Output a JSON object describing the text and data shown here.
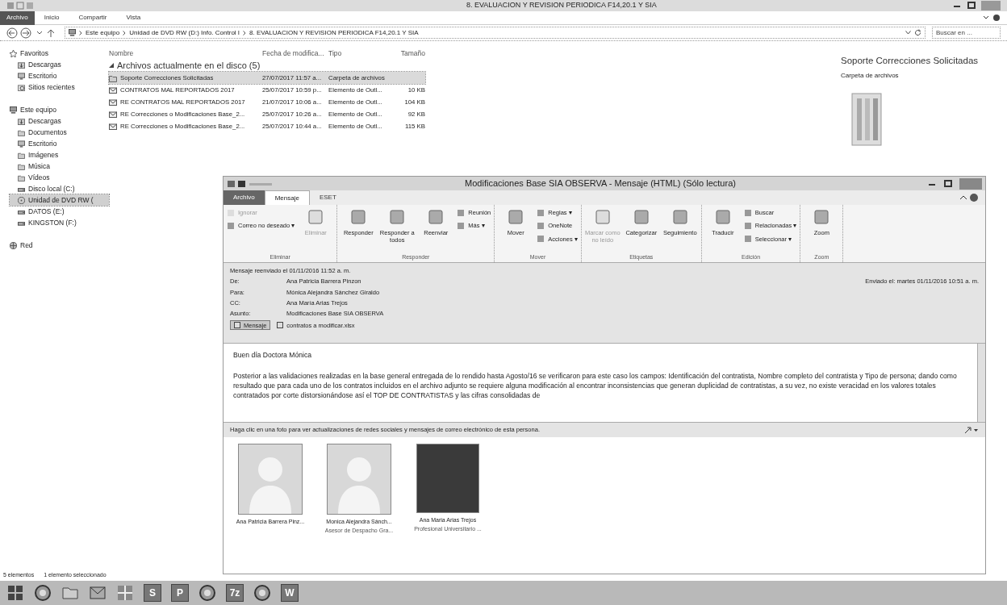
{
  "explorer": {
    "title": "8. EVALUACION Y REVISION PERIODICA F14,20.1 Y SIA",
    "tabs": [
      {
        "label": "Archivo",
        "selected": true
      },
      {
        "label": "Inicio",
        "selected": false
      },
      {
        "label": "Compartir",
        "selected": false
      },
      {
        "label": "Vista",
        "selected": false
      }
    ],
    "breadcrumb": [
      "Este equipo",
      "Unidad de DVD RW (D:) Info. Control I",
      "8. EVALUACION Y REVISION PERIODICA F14,20.1 Y SIA"
    ],
    "search": {
      "placeholder": "Buscar en ..."
    },
    "sidebar": [
      {
        "label": "Favoritos",
        "kind": "star",
        "selected": false,
        "children": [
          {
            "label": "Descargas",
            "kind": "download",
            "selected": false
          },
          {
            "label": "Escritorio",
            "kind": "desktop",
            "selected": false
          },
          {
            "label": "Sitios recientes",
            "kind": "recent",
            "selected": false
          }
        ]
      },
      {
        "label": "Este equipo",
        "kind": "computer",
        "selected": false,
        "children": [
          {
            "label": "Descargas",
            "kind": "download",
            "selected": false
          },
          {
            "label": "Documentos",
            "kind": "folder",
            "selected": false
          },
          {
            "label": "Escritorio",
            "kind": "desktop",
            "selected": false
          },
          {
            "label": "Imágenes",
            "kind": "folder",
            "selected": false
          },
          {
            "label": "Música",
            "kind": "folder",
            "selected": false
          },
          {
            "label": "Vídeos",
            "kind": "folder",
            "selected": false
          },
          {
            "label": "Disco local (C:)",
            "kind": "drive",
            "selected": false
          },
          {
            "label": "Unidad de DVD RW (",
            "kind": "disc",
            "selected": true
          },
          {
            "label": "DATOS (E:)",
            "kind": "drive",
            "selected": false
          },
          {
            "label": "KINGSTON (F:)",
            "kind": "drive",
            "selected": false
          }
        ]
      },
      {
        "label": "Red",
        "kind": "network",
        "selected": false
      }
    ],
    "table": {
      "columns": [
        "Nombre",
        "Fecha de modifica...",
        "Tipo",
        "Tamaño"
      ],
      "group": "Archivos actualmente en el disco (5)",
      "rows": [
        {
          "kind": "folder",
          "selected": true,
          "cells": [
            "Soporte Correcciones Solicitadas",
            "27/07/2017 11:57 a...",
            "Carpeta de archivos"
          ]
        },
        {
          "kind": "mail",
          "selected": false,
          "cells": [
            "CONTRATOS MAL REPORTADOS 2017",
            "25/07/2017 10:59 p...",
            "Elemento de Outl...",
            "10 KB"
          ]
        },
        {
          "kind": "mail",
          "selected": false,
          "cells": [
            "RE CONTRATOS MAL REPORTADOS 2017",
            "21/07/2017 10:06 a...",
            "Elemento de Outl...",
            "104 KB"
          ]
        },
        {
          "kind": "mail",
          "selected": false,
          "cells": [
            "RE Correcciones o Modificaciones Base_2...",
            "25/07/2017 10:26 a...",
            "Elemento de Outl...",
            "92 KB"
          ]
        },
        {
          "kind": "mail",
          "selected": false,
          "cells": [
            "RE Correcciones o Modificaciones Base_2...",
            "25/07/2017 10:44 a...",
            "Elemento de Outl...",
            "115 KB"
          ]
        }
      ]
    },
    "preview": {
      "title": "Soporte Correcciones Solicitadas",
      "subtitle": "Carpeta de archivos"
    },
    "status_bar": [
      "5 elementos",
      "1 elemento seleccionado"
    ]
  },
  "message_window": {
    "title": "Modificaciones Base SIA OBSERVA - Mensaje (HTML) (Sólo lectura)",
    "tabs": [
      {
        "label": "Archivo",
        "selected": false,
        "kind": "file"
      },
      {
        "label": "Mensaje",
        "selected": true,
        "kind": "tab"
      },
      {
        "label": "ESET",
        "selected": false,
        "kind": "tab"
      }
    ],
    "ribbon": [
      {
        "label": "Eliminar",
        "items": [
          {
            "label": "Ignorar",
            "kind": "small",
            "disabled": true
          },
          {
            "label": "Correo no deseado ▾",
            "kind": "small",
            "disabled": false
          },
          {
            "label": "Eliminar",
            "kind": "large",
            "disabled": true
          }
        ]
      },
      {
        "label": "Responder",
        "items": [
          {
            "label": "Responder",
            "kind": "large",
            "disabled": false
          },
          {
            "label": "Responder a todos",
            "kind": "large",
            "disabled": false
          },
          {
            "label": "Reenviar",
            "kind": "large",
            "disabled": false
          },
          {
            "label": "Reunión",
            "kind": "small",
            "disabled": false
          },
          {
            "label": "Más ▾",
            "kind": "small",
            "disabled": false
          }
        ]
      },
      {
        "label": "Mover",
        "items": [
          {
            "label": "Mover",
            "kind": "large",
            "disabled": false
          },
          {
            "label": "Reglas ▾",
            "kind": "small",
            "disabled": false
          },
          {
            "label": "OneNote",
            "kind": "small",
            "disabled": false
          },
          {
            "label": "Acciones ▾",
            "kind": "small",
            "disabled": false
          }
        ]
      },
      {
        "label": "Etiquetas",
        "items": [
          {
            "label": "Marcar como no leído",
            "kind": "large",
            "disabled": true
          },
          {
            "label": "Categorizar",
            "kind": "large",
            "disabled": false
          },
          {
            "label": "Seguimiento",
            "kind": "large",
            "disabled": false
          }
        ]
      },
      {
        "label": "Edición",
        "items": [
          {
            "label": "Traducir",
            "kind": "large",
            "disabled": false
          },
          {
            "label": "Buscar",
            "kind": "small",
            "disabled": false
          },
          {
            "label": "Relacionadas ▾",
            "kind": "small",
            "disabled": false
          },
          {
            "label": "Seleccionar ▾",
            "kind": "small",
            "disabled": false
          }
        ]
      },
      {
        "label": "Zoom",
        "items": [
          {
            "label": "Zoom",
            "kind": "large",
            "disabled": false
          }
        ]
      }
    ],
    "info": "Mensaje reenviado el 01/11/2016 11:52 a. m.",
    "fields": [
      {
        "label": "De:",
        "value": "Ana Patricia Barrera Pinzon"
      },
      {
        "label": "Para:",
        "value": "Mónica Alejandra Sánchez Giraldo"
      },
      {
        "label": "CC:",
        "value": "Ana María Arias Trejos"
      },
      {
        "label": "Asunto:",
        "value": "Modificaciones Base SIA OBSERVA"
      }
    ],
    "sent": "Enviado el: martes 01/11/2016 10:51 a. m.",
    "attachments": [
      {
        "label": "Mensaje",
        "selected": true
      },
      {
        "label": "contratos a modificar.xlsx",
        "selected": false
      }
    ],
    "body": [
      "Buen día Doctora Mónica",
      "Posterior a las validaciones realizadas en la base general entregada de lo rendido hasta Agosto/16 se verificaron para este caso los campos: Identificación del contratista, Nombre completo del contratista y Tipo de persona; dando como resultado que para cada uno de los contratos incluidos en el archivo adjunto se requiere alguna modificación al encontrar inconsistencias que generan duplicidad de contratistas, a su vez, no existe veracidad en los valores totales contratados por corte distorsionándose así el TOP DE CONTRATISTAS y las cifras consolidadas de"
    ],
    "people_hint": "Haga clic en una foto para ver actualizaciones de redes sociales y mensajes de correo electrónico de esta persona.",
    "people": [
      {
        "name": "Ana Patricia Barrera Pinz...",
        "kind": "silhouette"
      },
      {
        "name": "Monica Alejandra Sánch...",
        "role": "Asesor de Despacho Gra...",
        "kind": "silhouette"
      },
      {
        "name": "Ana Maria Arias Trejos",
        "role": "Profesional Universitario ...",
        "kind": "photo"
      }
    ]
  },
  "taskbar": [
    {
      "kind": "start"
    },
    {
      "kind": "browser"
    },
    {
      "kind": "folder"
    },
    {
      "kind": "mail"
    },
    {
      "kind": "app"
    },
    {
      "kind": "letter",
      "label": "S"
    },
    {
      "kind": "letter",
      "label": "P"
    },
    {
      "kind": "browser"
    },
    {
      "kind": "letter",
      "label": "7z"
    },
    {
      "kind": "browser"
    },
    {
      "kind": "letter",
      "label": "W"
    }
  ]
}
